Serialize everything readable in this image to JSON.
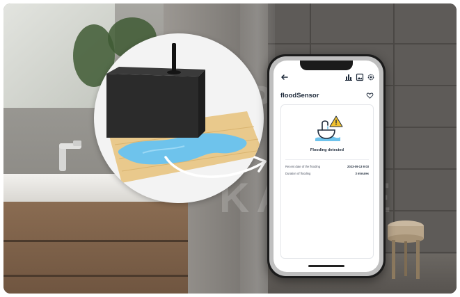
{
  "watermark": {
    "line1": "SPEC",
    "line2": "KABLE"
  },
  "app": {
    "title": "floodSensor",
    "status": "Flooding detected",
    "rows": [
      {
        "label": "Recent date of the flooding",
        "value": "2023-09-13 9:03"
      },
      {
        "label": "Duration of flooding",
        "value": "3 minutes"
      }
    ]
  },
  "icons": {
    "back": "arrow-left-icon",
    "chart": "bar-chart-icon",
    "photo": "image-icon",
    "settings": "gear-icon",
    "favorite": "heart-icon",
    "alert": "flood-sink-warning-icon"
  },
  "colors": {
    "accent": "#1e2a3a",
    "water": "#6ec3ec",
    "warning": "#f2c230",
    "sensor": "#2b2b2b",
    "floor": "#e9c98c"
  }
}
